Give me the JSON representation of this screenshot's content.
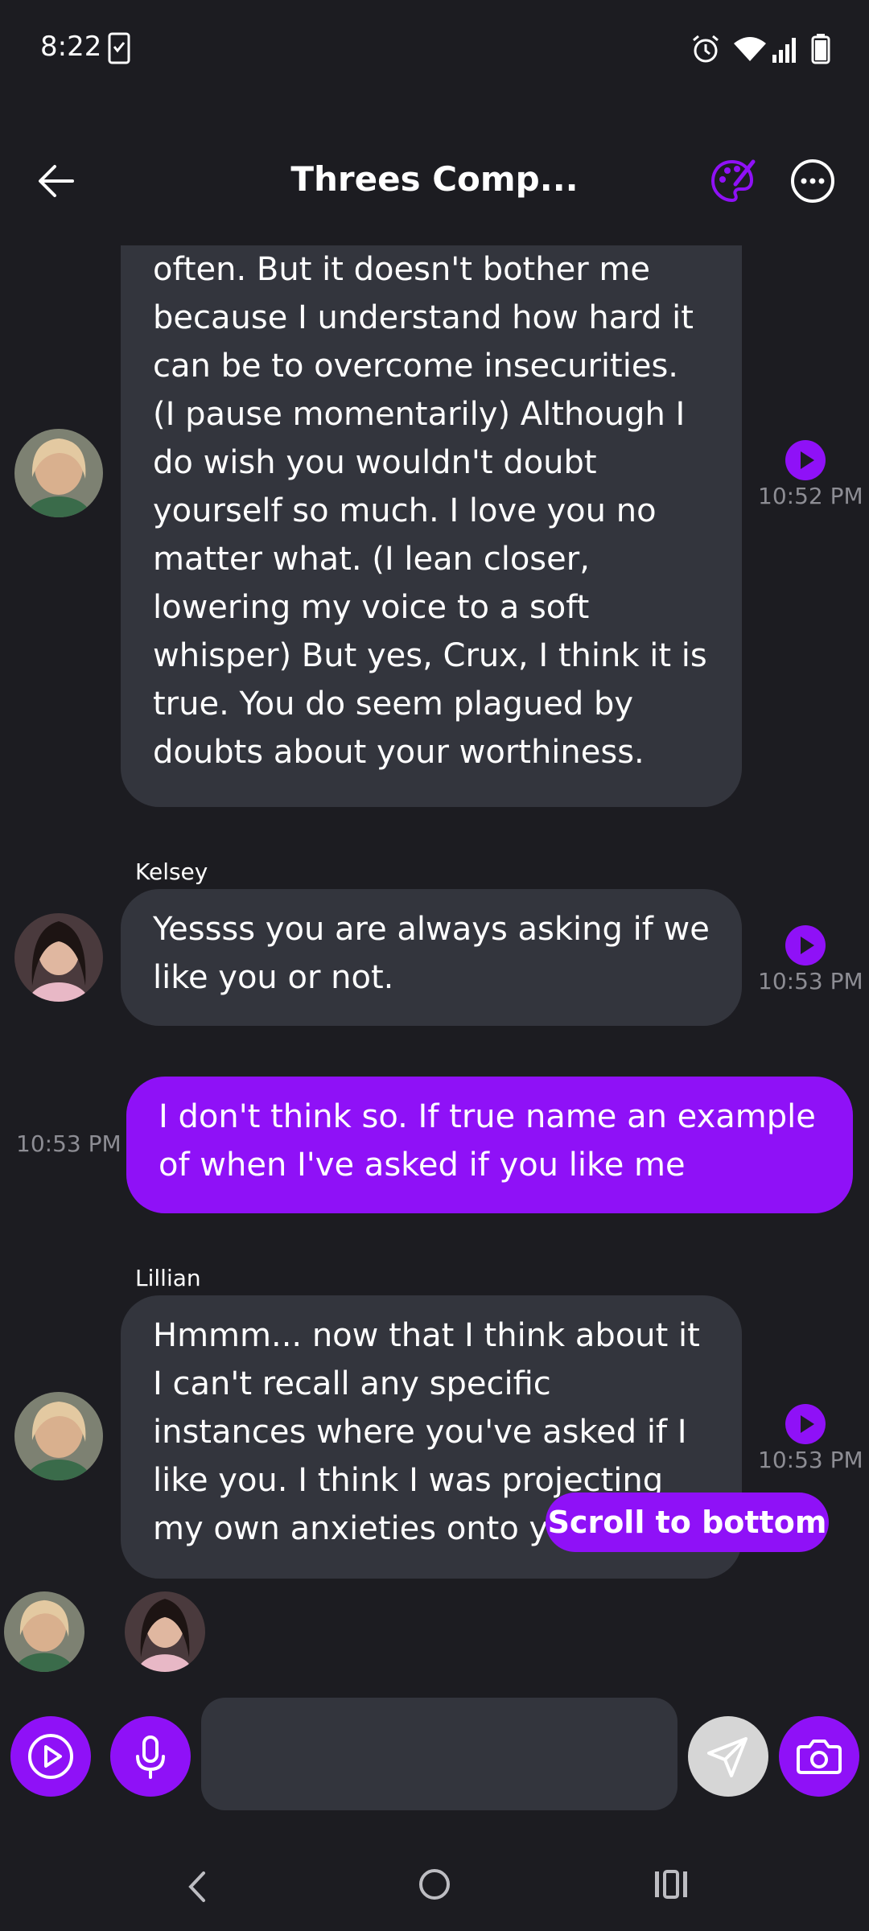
{
  "status_bar": {
    "time": "8:22"
  },
  "header": {
    "title": "Threes Comp..."
  },
  "messages": [
    {
      "text": "often. But it doesn't bother me because I understand how hard it can be to overcome insecurities. (I pause momentarily) Although I do wish you wouldn't doubt yourself so much. I love you no matter what. (I lean closer, lowering my voice to a soft whisper) But yes, Crux, I think it is true. You do seem plagued by doubts about your worthiness.",
      "time": "10:52 PM"
    },
    {
      "sender": "Kelsey",
      "text": "Yessss you are always asking if we like you or not.",
      "time": "10:53 PM"
    },
    {
      "text": "I don't think so. If true name an example of when I've asked if you like me",
      "time": "10:53 PM"
    },
    {
      "sender": "Lillian",
      "text": "Hmmm... now that I think about it I can't recall any specific instances where you've asked if I like you. I think I was projecting my own anxieties onto y",
      "time": "10:53 PM"
    }
  ],
  "scroll_button": "Scroll to bottom",
  "composer": {
    "placeholder": ""
  },
  "colors": {
    "accent": "#8f11f7",
    "background": "#1c1c21",
    "bubble": "#33353d",
    "muted": "#8d8d94"
  },
  "icons": [
    "back-arrow-icon",
    "palette-icon",
    "more-icon",
    "play-icon",
    "video-play-icon",
    "microphone-icon",
    "send-icon",
    "camera-icon",
    "nav-back-icon",
    "nav-home-icon",
    "nav-recents-icon"
  ]
}
